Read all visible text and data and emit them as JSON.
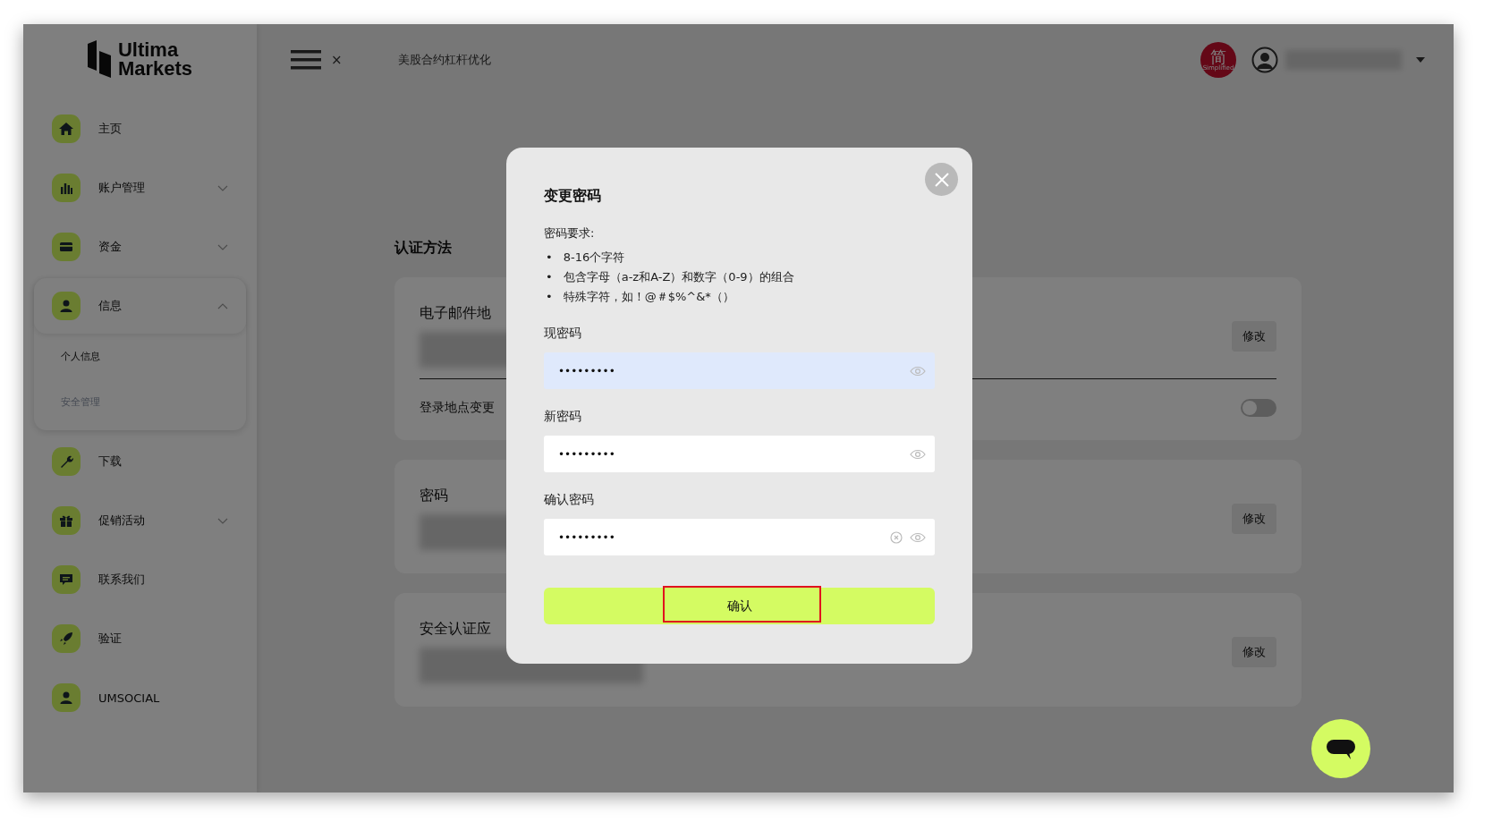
{
  "sidebar": {
    "logo": [
      "Ultima",
      "Markets"
    ],
    "items": [
      {
        "label": "主页",
        "has_chevron": false,
        "expanded": false
      },
      {
        "label": "账户管理",
        "has_chevron": true,
        "expanded": false
      },
      {
        "label": "资金",
        "has_chevron": true,
        "expanded": false
      },
      {
        "label": "信息",
        "has_chevron": true,
        "expanded": true,
        "children": [
          {
            "label": "个人信息",
            "selected": false
          },
          {
            "label": "安全管理",
            "selected": true
          }
        ]
      },
      {
        "label": "下载",
        "has_chevron": false,
        "expanded": false
      },
      {
        "label": "促销活动",
        "has_chevron": true,
        "expanded": false
      },
      {
        "label": "联系我们",
        "has_chevron": false,
        "expanded": false
      },
      {
        "label": "验证",
        "has_chevron": false,
        "expanded": false
      },
      {
        "label": "UMSOCIAL",
        "has_chevron": false,
        "expanded": false
      }
    ]
  },
  "topbar": {
    "close": "×",
    "breadcrumb": "美股合约杠杆优化",
    "language": {
      "glyph": "简",
      "caption": "Simplified"
    }
  },
  "content": {
    "section_title": "认证方法",
    "cards": [
      {
        "title": "电子邮件地",
        "button": "修改",
        "toggle_row": {
          "label": "登录地点变更",
          "on": false
        }
      },
      {
        "title": "密码",
        "button": "修改"
      },
      {
        "title": "安全认证应",
        "button": "修改"
      }
    ]
  },
  "modal": {
    "title": "变更密码",
    "requirements_title": "密码要求:",
    "requirements": [
      {
        "marker": "•",
        "text": "8-16个字符"
      },
      {
        "marker": "•",
        "text": "包含字母（a-z和A-Z）和数字（0-9）的组合"
      },
      {
        "marker": "•",
        "text": "特殊字符，如！@＃$%^&*（）"
      }
    ],
    "fields": [
      {
        "label": "现密码",
        "value": "•••••••••",
        "focused": true,
        "clearable": false
      },
      {
        "label": "新密码",
        "value": "•••••••••",
        "focused": false,
        "clearable": false
      },
      {
        "label": "确认密码",
        "value": "•••••••••",
        "focused": false,
        "clearable": true
      }
    ],
    "confirm": {
      "label": "确认",
      "highlighted": true
    }
  }
}
